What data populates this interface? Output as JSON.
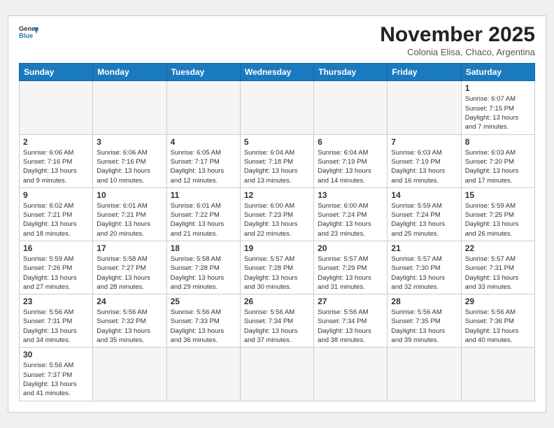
{
  "header": {
    "logo_text_general": "General",
    "logo_text_blue": "Blue",
    "month_title": "November 2025",
    "subtitle": "Colonia Elisa, Chaco, Argentina"
  },
  "weekdays": [
    "Sunday",
    "Monday",
    "Tuesday",
    "Wednesday",
    "Thursday",
    "Friday",
    "Saturday"
  ],
  "weeks": [
    [
      {
        "day": "",
        "info": ""
      },
      {
        "day": "",
        "info": ""
      },
      {
        "day": "",
        "info": ""
      },
      {
        "day": "",
        "info": ""
      },
      {
        "day": "",
        "info": ""
      },
      {
        "day": "",
        "info": ""
      },
      {
        "day": "1",
        "info": "Sunrise: 6:07 AM\nSunset: 7:15 PM\nDaylight: 13 hours and 7 minutes."
      }
    ],
    [
      {
        "day": "2",
        "info": "Sunrise: 6:06 AM\nSunset: 7:16 PM\nDaylight: 13 hours and 9 minutes."
      },
      {
        "day": "3",
        "info": "Sunrise: 6:06 AM\nSunset: 7:16 PM\nDaylight: 13 hours and 10 minutes."
      },
      {
        "day": "4",
        "info": "Sunrise: 6:05 AM\nSunset: 7:17 PM\nDaylight: 13 hours and 12 minutes."
      },
      {
        "day": "5",
        "info": "Sunrise: 6:04 AM\nSunset: 7:18 PM\nDaylight: 13 hours and 13 minutes."
      },
      {
        "day": "6",
        "info": "Sunrise: 6:04 AM\nSunset: 7:19 PM\nDaylight: 13 hours and 14 minutes."
      },
      {
        "day": "7",
        "info": "Sunrise: 6:03 AM\nSunset: 7:19 PM\nDaylight: 13 hours and 16 minutes."
      },
      {
        "day": "8",
        "info": "Sunrise: 6:03 AM\nSunset: 7:20 PM\nDaylight: 13 hours and 17 minutes."
      }
    ],
    [
      {
        "day": "9",
        "info": "Sunrise: 6:02 AM\nSunset: 7:21 PM\nDaylight: 13 hours and 18 minutes."
      },
      {
        "day": "10",
        "info": "Sunrise: 6:01 AM\nSunset: 7:21 PM\nDaylight: 13 hours and 20 minutes."
      },
      {
        "day": "11",
        "info": "Sunrise: 6:01 AM\nSunset: 7:22 PM\nDaylight: 13 hours and 21 minutes."
      },
      {
        "day": "12",
        "info": "Sunrise: 6:00 AM\nSunset: 7:23 PM\nDaylight: 13 hours and 22 minutes."
      },
      {
        "day": "13",
        "info": "Sunrise: 6:00 AM\nSunset: 7:24 PM\nDaylight: 13 hours and 23 minutes."
      },
      {
        "day": "14",
        "info": "Sunrise: 5:59 AM\nSunset: 7:24 PM\nDaylight: 13 hours and 25 minutes."
      },
      {
        "day": "15",
        "info": "Sunrise: 5:59 AM\nSunset: 7:25 PM\nDaylight: 13 hours and 26 minutes."
      }
    ],
    [
      {
        "day": "16",
        "info": "Sunrise: 5:59 AM\nSunset: 7:26 PM\nDaylight: 13 hours and 27 minutes."
      },
      {
        "day": "17",
        "info": "Sunrise: 5:58 AM\nSunset: 7:27 PM\nDaylight: 13 hours and 28 minutes."
      },
      {
        "day": "18",
        "info": "Sunrise: 5:58 AM\nSunset: 7:28 PM\nDaylight: 13 hours and 29 minutes."
      },
      {
        "day": "19",
        "info": "Sunrise: 5:57 AM\nSunset: 7:28 PM\nDaylight: 13 hours and 30 minutes."
      },
      {
        "day": "20",
        "info": "Sunrise: 5:57 AM\nSunset: 7:29 PM\nDaylight: 13 hours and 31 minutes."
      },
      {
        "day": "21",
        "info": "Sunrise: 5:57 AM\nSunset: 7:30 PM\nDaylight: 13 hours and 32 minutes."
      },
      {
        "day": "22",
        "info": "Sunrise: 5:57 AM\nSunset: 7:31 PM\nDaylight: 13 hours and 33 minutes."
      }
    ],
    [
      {
        "day": "23",
        "info": "Sunrise: 5:56 AM\nSunset: 7:31 PM\nDaylight: 13 hours and 34 minutes."
      },
      {
        "day": "24",
        "info": "Sunrise: 5:56 AM\nSunset: 7:32 PM\nDaylight: 13 hours and 35 minutes."
      },
      {
        "day": "25",
        "info": "Sunrise: 5:56 AM\nSunset: 7:33 PM\nDaylight: 13 hours and 36 minutes."
      },
      {
        "day": "26",
        "info": "Sunrise: 5:56 AM\nSunset: 7:34 PM\nDaylight: 13 hours and 37 minutes."
      },
      {
        "day": "27",
        "info": "Sunrise: 5:56 AM\nSunset: 7:34 PM\nDaylight: 13 hours and 38 minutes."
      },
      {
        "day": "28",
        "info": "Sunrise: 5:56 AM\nSunset: 7:35 PM\nDaylight: 13 hours and 39 minutes."
      },
      {
        "day": "29",
        "info": "Sunrise: 5:56 AM\nSunset: 7:36 PM\nDaylight: 13 hours and 40 minutes."
      }
    ],
    [
      {
        "day": "30",
        "info": "Sunrise: 5:56 AM\nSunset: 7:37 PM\nDaylight: 13 hours and 41 minutes."
      },
      {
        "day": "",
        "info": ""
      },
      {
        "day": "",
        "info": ""
      },
      {
        "day": "",
        "info": ""
      },
      {
        "day": "",
        "info": ""
      },
      {
        "day": "",
        "info": ""
      },
      {
        "day": "",
        "info": ""
      }
    ]
  ]
}
